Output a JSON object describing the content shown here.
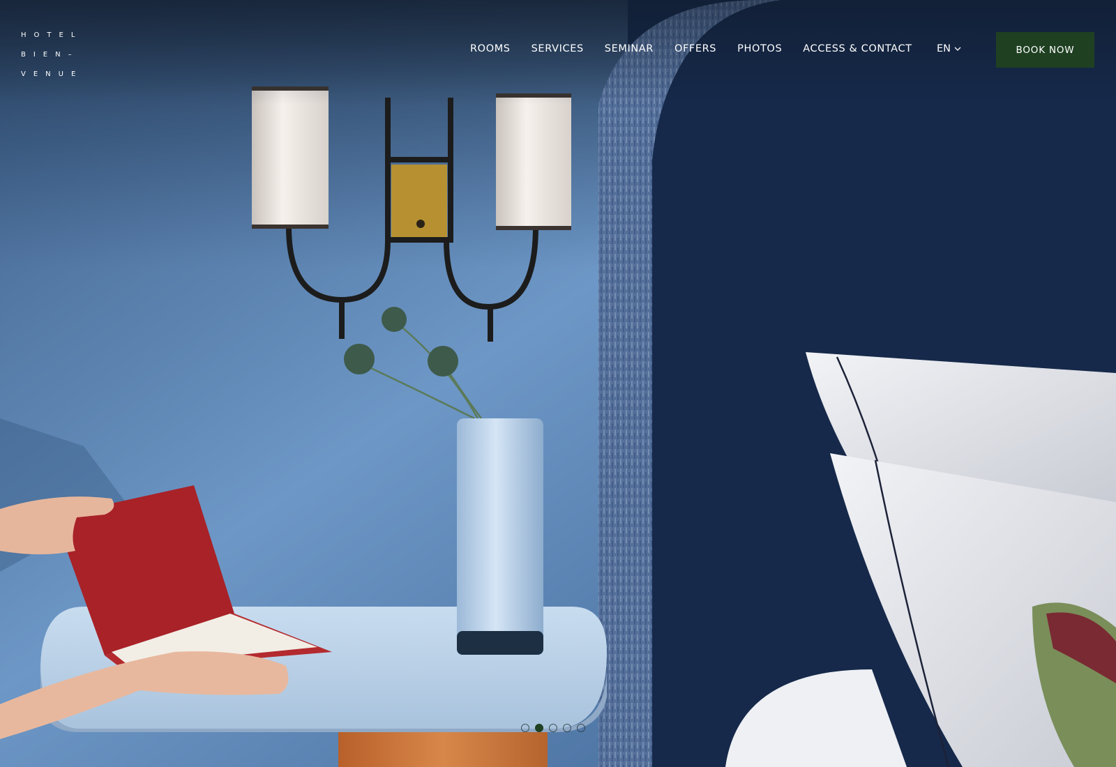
{
  "logo": {
    "line1": "HOTEL",
    "line2": "BIEN–",
    "line3": "VENUE"
  },
  "nav": {
    "items": [
      "ROOMS",
      "SERVICES",
      "SEMINAR",
      "OFFERS",
      "PHOTOS",
      "ACCESS & CONTACT"
    ]
  },
  "language": {
    "selected": "EN",
    "icon": "chevron-down-icon"
  },
  "booking": {
    "label": "BOOK NOW",
    "color": "#1f4122"
  },
  "slider": {
    "total": 5,
    "active_index": 2
  },
  "colors": {
    "accent": "#1f4122",
    "wall": "#5f89b8",
    "headboard": "#142848"
  }
}
